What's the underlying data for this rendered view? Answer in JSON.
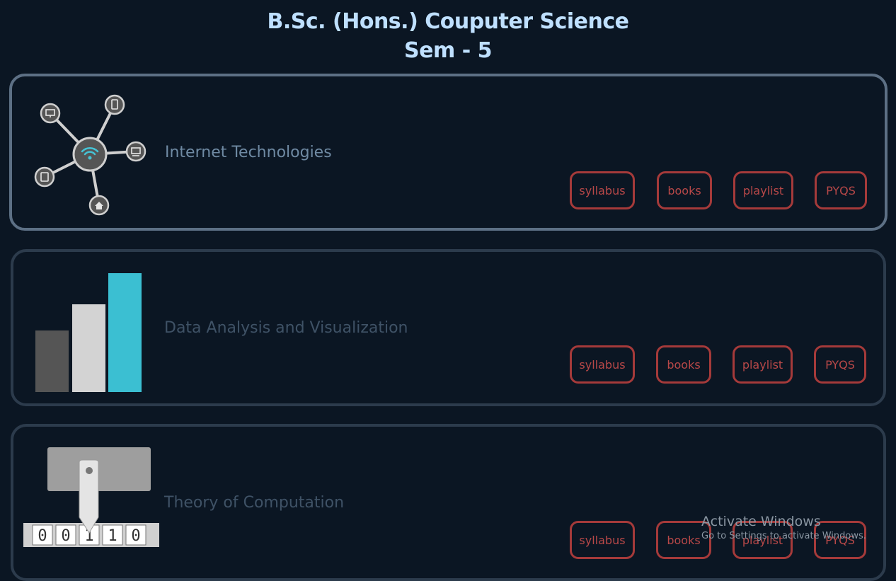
{
  "header": {
    "title_line1": "B.Sc. (Hons.) Couputer Science",
    "title_line2": "Sem - 5"
  },
  "courses": [
    {
      "name": "Internet Technologies",
      "icon": "network-icon",
      "buttons": [
        "syllabus",
        "books",
        "playlist",
        "PYQS"
      ]
    },
    {
      "name": "Data Analysis and Visualization",
      "icon": "bar-chart-icon",
      "buttons": [
        "syllabus",
        "books",
        "playlist",
        "PYQS"
      ]
    },
    {
      "name": "Theory of Computation",
      "icon": "turing-machine-icon",
      "tape": [
        "0",
        "0",
        "1",
        "1",
        "0"
      ],
      "buttons": [
        "syllabus",
        "books",
        "playlist",
        "PYQS"
      ]
    }
  ],
  "watermark": {
    "line1": "Activate Windows",
    "line2": "Go to Settings to activate Windows."
  },
  "colors": {
    "background": "#0b1623",
    "title": "#bfe0ff",
    "button": "#a53a3a",
    "active_border": "#5d7085",
    "bar1": "#555555",
    "bar2": "#d3d3d3",
    "bar3": "#3bbfd2"
  }
}
